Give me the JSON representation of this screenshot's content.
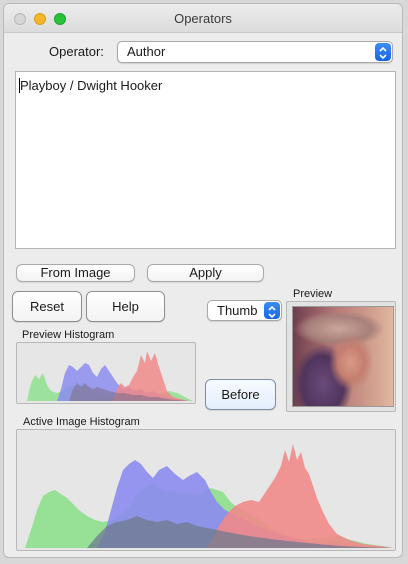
{
  "window": {
    "title": "Operators"
  },
  "operator": {
    "label": "Operator:",
    "selected": "Author"
  },
  "text_area": {
    "value": "Playboy / Dwight Hooker"
  },
  "buttons": {
    "from_image": "From Image",
    "apply": "Apply",
    "reset": "Reset",
    "help": "Help",
    "before": "Before"
  },
  "preview_mode": {
    "selected": "Thumb"
  },
  "labels": {
    "preview": "Preview",
    "preview_histogram": "Preview Histogram",
    "active_image_histogram": "Active Image Histogram"
  },
  "colors": {
    "hist_red": "#f08a8a",
    "hist_green": "#8ee08e",
    "hist_blue": "#8c8cf0",
    "stepper": "#1f6fe5"
  }
}
